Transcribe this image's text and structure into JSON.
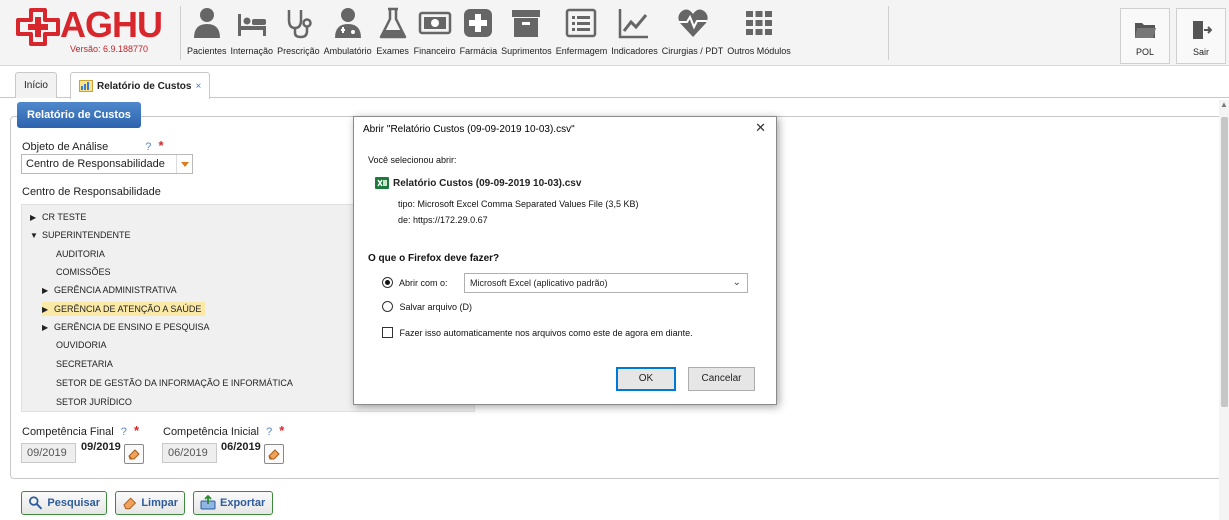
{
  "app": {
    "logo_text": "AGHU",
    "version": "Versão: 6.9.188770",
    "brand_color": "#d7262c"
  },
  "modules": [
    {
      "label": "Pacientes",
      "icon": "user-icon"
    },
    {
      "label": "Internação",
      "icon": "bed-icon"
    },
    {
      "label": "Prescrição",
      "icon": "stethoscope-icon"
    },
    {
      "label": "Ambulatório",
      "icon": "doctor-icon"
    },
    {
      "label": "Exames",
      "icon": "flask-icon"
    },
    {
      "label": "Financeiro",
      "icon": "money-icon"
    },
    {
      "label": "Farmácia",
      "icon": "medical-cross-icon"
    },
    {
      "label": "Suprimentos",
      "icon": "box-icon"
    },
    {
      "label": "Enfermagem",
      "icon": "list-icon"
    },
    {
      "label": "Indicadores",
      "icon": "chart-line-icon"
    },
    {
      "label": "Cirurgias / PDT",
      "icon": "heartbeat-icon"
    },
    {
      "label": "Outros Módulos",
      "icon": "grid-icon"
    }
  ],
  "right_buttons": {
    "pol": "POL",
    "sair": "Sair"
  },
  "tabs": [
    {
      "label": "Início",
      "active": false
    },
    {
      "label": "Relatório de Custos",
      "close": "×",
      "active": true
    }
  ],
  "form": {
    "panel_title": "Relatório de Custos",
    "objeto_label": "Objeto de Análise",
    "help_mark": "?",
    "required_mark": "*",
    "objeto_value": "Centro de Responsabilidade",
    "centro_label": "Centro de Responsabilidade",
    "tree": {
      "cr_teste": "CR TESTE",
      "superintendente": "SUPERINTENDENTE",
      "auditoria": "AUDITORIA",
      "comissoes": "COMISSÕES",
      "ger_admin": "GERÊNCIA ADMINISTRATIVA",
      "ger_atencao": "GERÊNCIA DE ATENÇÃO A SAÚDE",
      "ger_ensino": "GERÊNCIA DE ENSINO E PESQUISA",
      "ouvidoria": "OUVIDORIA",
      "secretaria": "SECRETARIA",
      "setor_gestao": "SETOR DE GESTÃO DA INFORMAÇÃO E INFORMÁTICA",
      "setor_juridico": "SETOR JURÍDICO"
    },
    "comp_final_label": "Competência Final",
    "comp_final_input": "09/2019",
    "comp_final_value": "09/2019",
    "comp_inicial_label": "Competência Inicial",
    "comp_inicial_input": "06/2019",
    "comp_inicial_value": "06/2019"
  },
  "actions": {
    "pesquisar": "Pesquisar",
    "limpar": "Limpar",
    "exportar": "Exportar"
  },
  "dialog": {
    "title": "Abrir \"Relatório Custos (09-09-2019 10-03).csv\"",
    "close": "✕",
    "selected_text": "Você selecionou abrir:",
    "filename": "Relatório Custos (09-09-2019 10-03).csv",
    "type_label": "tipo:",
    "type_value": "Microsoft Excel Comma Separated Values File (3,5 KB)",
    "from_label": "de:",
    "from_value": "https://172.29.0.67",
    "question": "O que o Firefox deve fazer?",
    "open_with_label": "Abrir com o:",
    "open_with_value": "Microsoft Excel (aplicativo padrão)",
    "save_label": "Salvar arquivo (D)",
    "auto_label": "Fazer isso automaticamente nos arquivos como este de agora em diante.",
    "ok": "OK",
    "cancel": "Cancelar"
  }
}
